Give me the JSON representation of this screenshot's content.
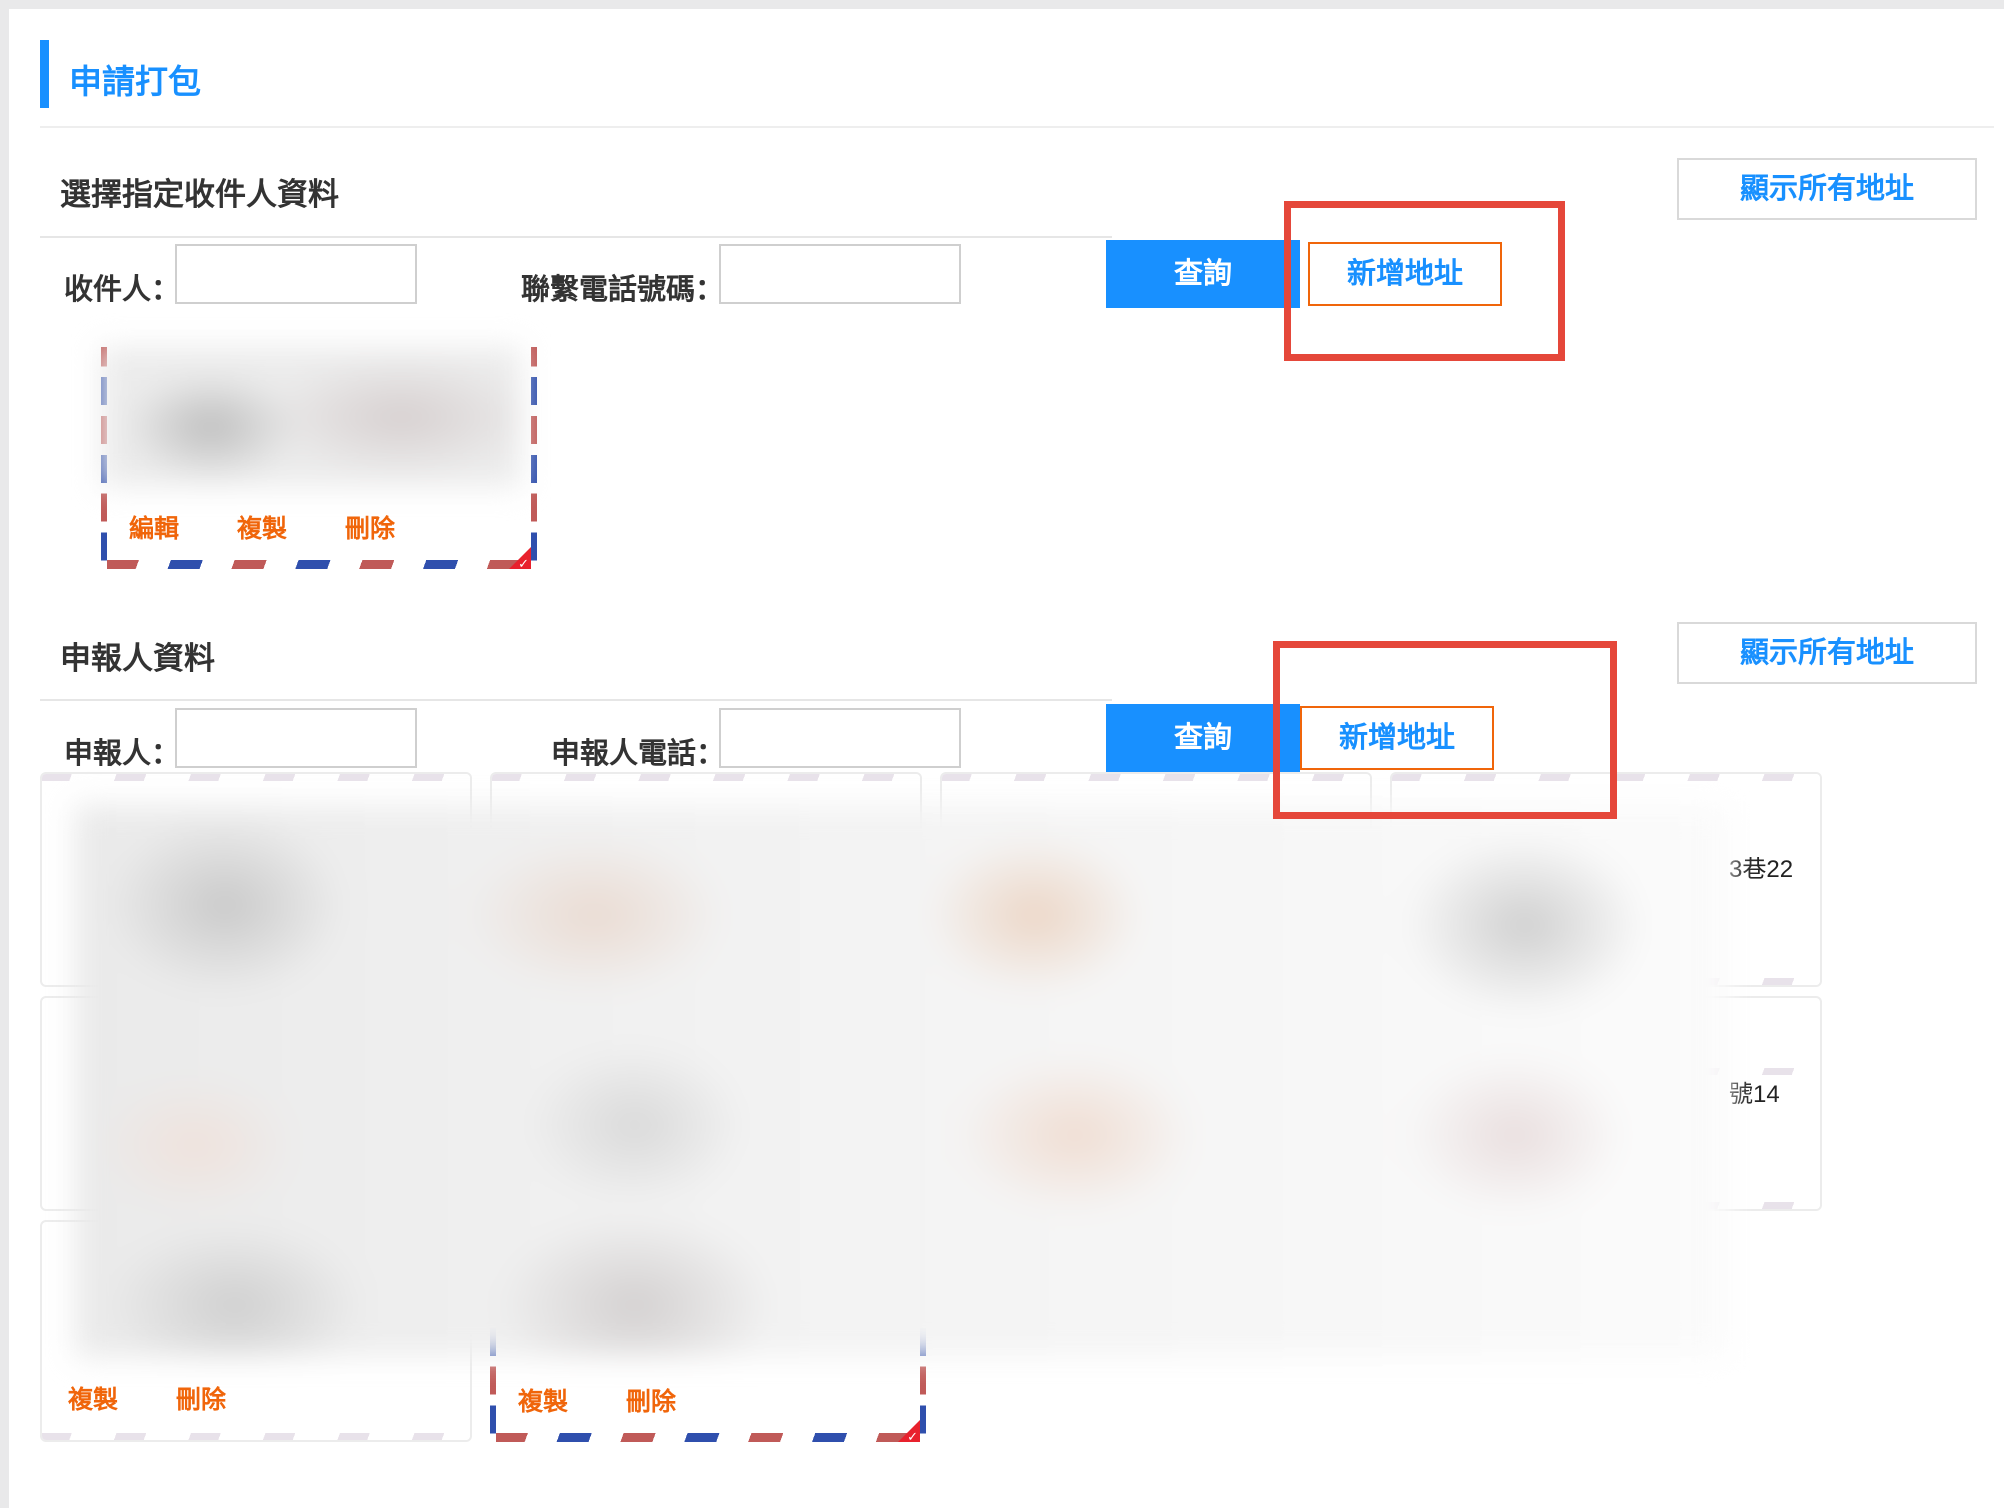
{
  "page": {
    "title": "申請打包"
  },
  "recipient_section": {
    "title": "選擇指定收件人資料",
    "show_all_label": "顯示所有地址",
    "recipient_label": "收件人：",
    "recipient_value": "",
    "phone_label": "聯繫電話號碼：",
    "phone_value": "",
    "query_label": "查詢",
    "add_label": "新增地址",
    "card": {
      "edit": "編輯",
      "copy": "複製",
      "delete": "刪除"
    }
  },
  "declarant_section": {
    "title": "申報人資料",
    "show_all_label": "顯示所有地址",
    "declarant_label": "申報人：",
    "declarant_value": "",
    "phone_label": "申報人電話：",
    "phone_value": "",
    "query_label": "查詢",
    "add_label": "新增地址",
    "card_fragments": [
      "3巷22",
      "號14"
    ],
    "bottom_cards": [
      {
        "copy": "複製",
        "delete": "刪除"
      },
      {
        "copy": "複製",
        "delete": "刪除"
      }
    ]
  },
  "colors": {
    "accent": "#1890ff",
    "action_orange": "#f0650a",
    "highlight_red": "#e5473a"
  }
}
